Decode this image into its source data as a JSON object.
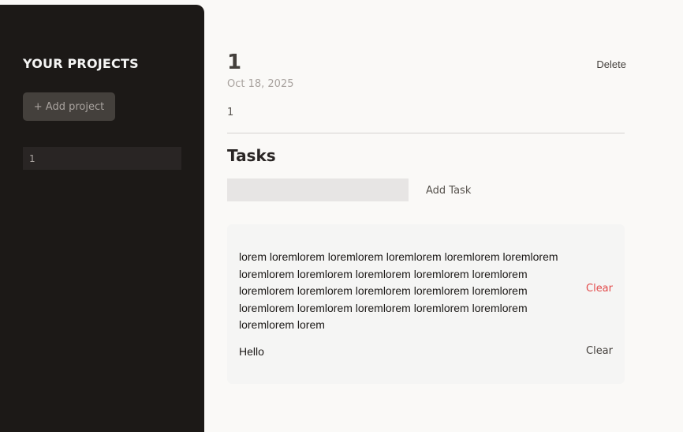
{
  "sidebar": {
    "title": "YOUR PROJECTS",
    "add_project_label": "+ Add project",
    "projects": [
      {
        "label": "1"
      }
    ]
  },
  "project": {
    "title": "1",
    "delete_label": "Delete",
    "date": "Oct 18, 2025",
    "description": "1"
  },
  "tasks": {
    "heading": "Tasks",
    "input_value": "",
    "input_placeholder": "",
    "add_label": "Add Task",
    "items": [
      {
        "text": "lorem loremlorem loremlorem loremlorem loremlorem loremlorem loremlorem loremlorem loremlorem loremlorem loremlorem loremlorem loremlorem loremlorem loremlorem loremlorem loremlorem loremlorem loremlorem loremlorem loremlorem loremlorem lorem",
        "clear_label": "Clear"
      },
      {
        "text": "Hello",
        "clear_label": "Clear"
      }
    ]
  },
  "colors": {
    "sidebar_bg": "#1c1917",
    "page_bg": "#faf9f7",
    "clear_hover": "#e34b4b",
    "muted_text": "#a8a29e"
  }
}
